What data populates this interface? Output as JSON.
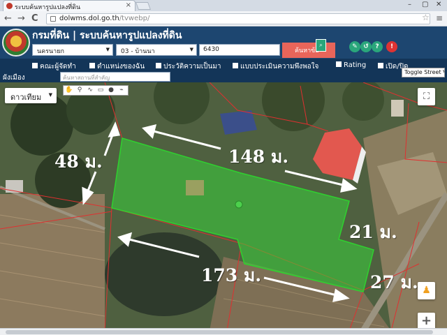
{
  "browser": {
    "tab_title": "ระบบค้นหารูปแปลงที่ดิน",
    "tab_close": "×",
    "url_host": "dolwms.dol.go.th",
    "url_path": "/tvwebp/",
    "win_min": "–",
    "win_max": "▢",
    "win_close": "✕",
    "back": "←",
    "forward": "→",
    "reload": "C",
    "star": "☆",
    "menu": "≡"
  },
  "header": {
    "title": "กรมที่ดิน | ระบบค้นหารูปแปลงที่ดิน",
    "province_select": "นครนายก",
    "district_select": "03 - บ้านนา",
    "parcel_input": "6430",
    "search_button": "ค้นหาข้อ",
    "search_glyph": "⌕"
  },
  "layers": [
    {
      "label": "คณะผู้จัดทำ"
    },
    {
      "label": "ตำแหน่งของฉัน"
    },
    {
      "label": "ประวัติความเป็นมา"
    },
    {
      "label": "แบบประเมินความพึงพอใจ"
    },
    {
      "label": "Rating"
    },
    {
      "label": "เปิด/ปิด"
    },
    {
      "label": "ผังเมือง"
    }
  ],
  "place_input_placeholder": "ค้นหาสถานที่สำคัญ",
  "toggle_street_view": "Toggle Street Vi",
  "map": {
    "map_type": "ดาวเทียม",
    "fullscreen": "⛶",
    "pegman": "♟",
    "zoom_in": "+",
    "tools": [
      "✋",
      "⚲",
      "∿",
      "▭",
      "●",
      "⌁"
    ],
    "dimensions": {
      "left": "48 ม.",
      "top": "148 ม.",
      "right_short": "21 ม.",
      "bottom": "173 ม.",
      "right_long": "27 ม."
    }
  },
  "colors": {
    "header_bg": "#1d4670",
    "layerbar_bg": "#133558",
    "parcel_fill": "#39d43a",
    "boundary_line": "#e03030",
    "search_button": "#e8655a"
  }
}
